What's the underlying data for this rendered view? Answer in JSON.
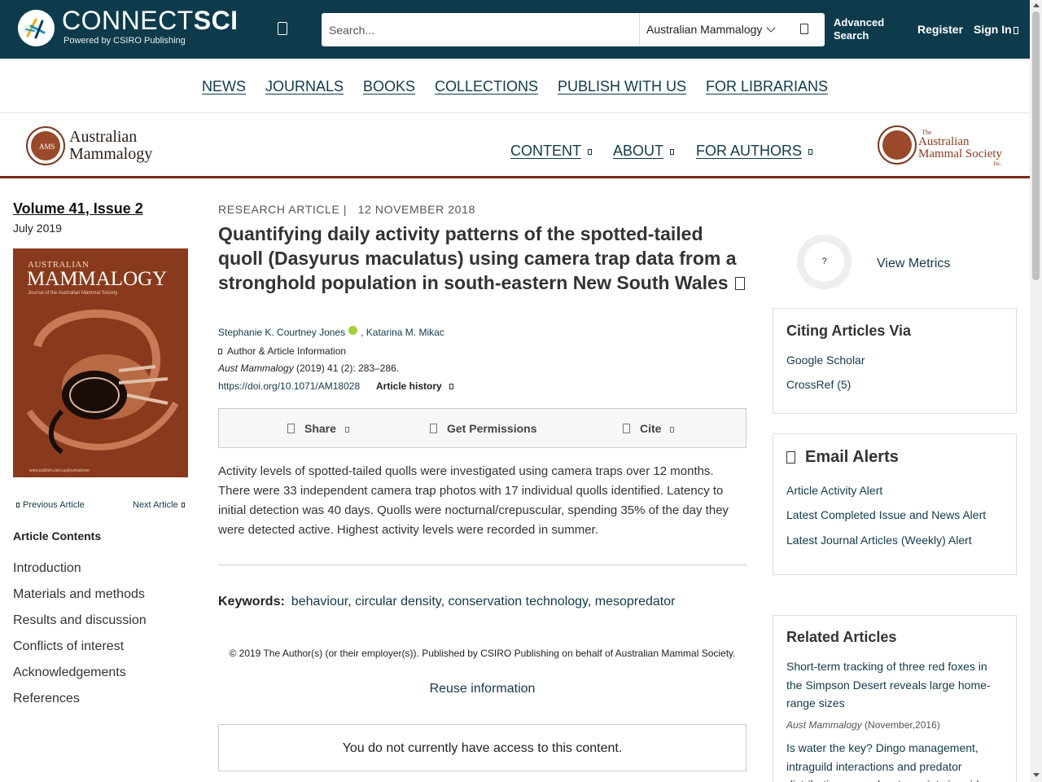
{
  "header": {
    "brand_light": "CONNECT",
    "brand_bold": "SCI",
    "brand_sub": "Powered by CSIRO Publishing",
    "search_placeholder": "Search...",
    "search_scope": "Australian Mammalogy",
    "advanced_search": "Advanced Search",
    "register": "Register",
    "sign_in": "Sign In"
  },
  "main_nav": [
    "NEWS",
    "JOURNALS",
    "BOOKS",
    "COLLECTIONS",
    "PUBLISH WITH US",
    "FOR LIBRARIANS"
  ],
  "journal": {
    "logo_letters": "AMS",
    "name_line1": "Australian",
    "name_line2": "Mammalogy",
    "nav": [
      "CONTENT",
      "ABOUT",
      "FOR AUTHORS"
    ],
    "society_the": "The",
    "society_line1": "Australian",
    "society_line2": "Mammal Society",
    "society_inc": "Inc."
  },
  "sidebar": {
    "issue_title": "Volume 41, Issue 2",
    "issue_date": "July 2019",
    "cover_small": "AUSTRALIAN",
    "cover_big": "MAMMALOGY",
    "cover_sub": "Journal of the Australian Mammal Society",
    "cover_url": "www.publish.csiro.au/journals/am",
    "prev_article": "Previous Article",
    "next_article": "Next Article",
    "contents_heading": "Article Contents",
    "toc": [
      "Introduction",
      "Materials and methods",
      "Results and discussion",
      "Conflicts of interest",
      "Acknowledgements",
      "References"
    ]
  },
  "article": {
    "type": "RESEARCH ARTICLE",
    "separator": "|",
    "date": "12 NOVEMBER 2018",
    "title": "Quantifying daily activity patterns of the spotted-tailed quoll (Dasyurus maculatus) using camera trap data from a stronghold population in south-eastern New South Wales",
    "author1": "Stephanie K. Courtney Jones",
    "author2": "Katarina M. Mikac",
    "author_info": "Author & Article Information",
    "citation_journal": "Aust Mammalogy",
    "citation_rest": " (2019) 41 (2): 283–286.",
    "doi": "https://doi.org/10.1071/AM18028",
    "history": "Article history",
    "tools": [
      "Share",
      "Get Permissions",
      "Cite"
    ],
    "abstract": "Activity levels of spotted-tailed quolls were investigated using camera traps over 12 months. There were 33 independent camera trap photos with 17 individual quolls identified. Latency to initial detection was 40 days. Quolls were nocturnal/crepuscular, spending 35% of the day they were detected active. Highest activity levels were recorded in summer.",
    "keywords_label": "Keywords:",
    "keywords": [
      "behaviour",
      "circular density",
      "conservation technology",
      "mesopredator"
    ],
    "copyright": "© 2019 The Author(s) (or their employer(s)). Published by CSIRO Publishing on behalf of Australian Mammal Society.",
    "reuse": "Reuse information",
    "access": "You do not currently have access to this content."
  },
  "right": {
    "metrics_symbol": "?",
    "view_metrics": "View Metrics",
    "citing_heading": "Citing Articles Via",
    "citing_links": [
      "Google Scholar",
      "CrossRef (5)"
    ],
    "alerts_heading": "Email Alerts",
    "alert_links": [
      "Article Activity Alert",
      "Latest Completed Issue and News Alert",
      "Latest Journal Articles (Weekly) Alert"
    ],
    "related_heading": "Related Articles",
    "related": [
      {
        "title": "Short-term tracking of three red foxes in the Simpson Desert reveals large home-range sizes",
        "journal": "Aust Mammalogy",
        "date": " (November,2016)"
      },
      {
        "title": "Is water the key? Dingo management, intraguild interactions and predator distribution around water points in arid",
        "journal": "",
        "date": ""
      }
    ]
  },
  "colors": {
    "header_bg": "#0d3b4c",
    "link": "#123a4a",
    "journal_brown": "#7a2a1a",
    "cover_bg": "#8a3a1c"
  }
}
